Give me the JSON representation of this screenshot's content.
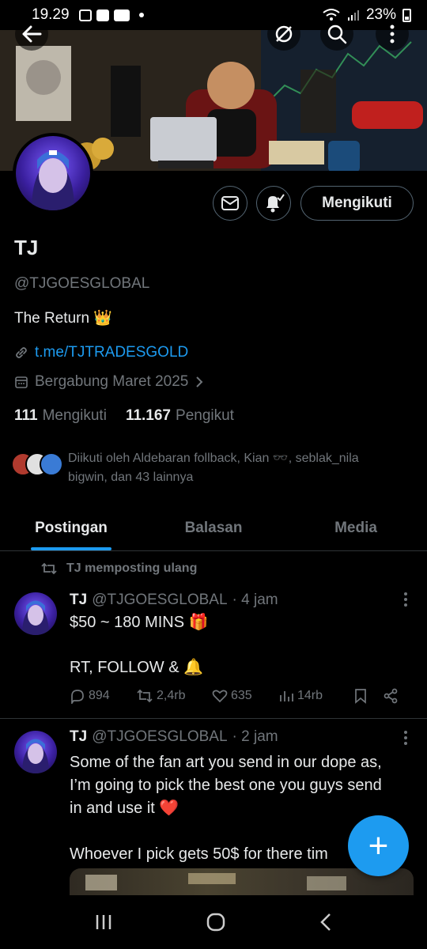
{
  "status": {
    "time": "19.29",
    "battery": "23%"
  },
  "profile": {
    "name": "TJ",
    "handle": "@TJGOESGLOBAL",
    "bio": "The Return 👑",
    "link": "t.me/TJTRADESGOLD",
    "joined": "Bergabung Maret 2025",
    "following_count": "111",
    "following_label": "Mengikuti",
    "followers_count": "11.167",
    "followers_label": "Pengikut",
    "follow_button": "Mengikuti",
    "followed_by_line1": "Diikuti oleh Aldebaran follback, Kian 🕶️, seblak_nila",
    "followed_by_line2": "bigwin, dan 43 lainnya"
  },
  "tabs": [
    {
      "label": "Postingan",
      "active": true
    },
    {
      "label": "Balasan",
      "active": false
    },
    {
      "label": "Media",
      "active": false
    }
  ],
  "posts": [
    {
      "repost_label": "TJ memposting ulang",
      "name": "TJ",
      "handle": "@TJGOESGLOBAL",
      "time": "· 4 jam",
      "text_line1": "$50 ~ 180 MINS 🎁",
      "text_line2": "RT, FOLLOW & 🔔",
      "replies": "894",
      "reposts": "2,4rb",
      "likes": "635",
      "views": "14rb"
    },
    {
      "name": "TJ",
      "handle": "@TJGOESGLOBAL",
      "time": "· 2 jam",
      "text": "Some of the fan art you send in our dope as,\nI’m going to pick the best one you guys send\nin and use it ❤️\n\nWhoever I pick gets 50$ for there tim"
    }
  ],
  "fab_label": "+",
  "colors": {
    "accent": "#1d9bf0",
    "muted": "#71767b",
    "text": "#e7e9ea",
    "border": "#2f3336"
  }
}
